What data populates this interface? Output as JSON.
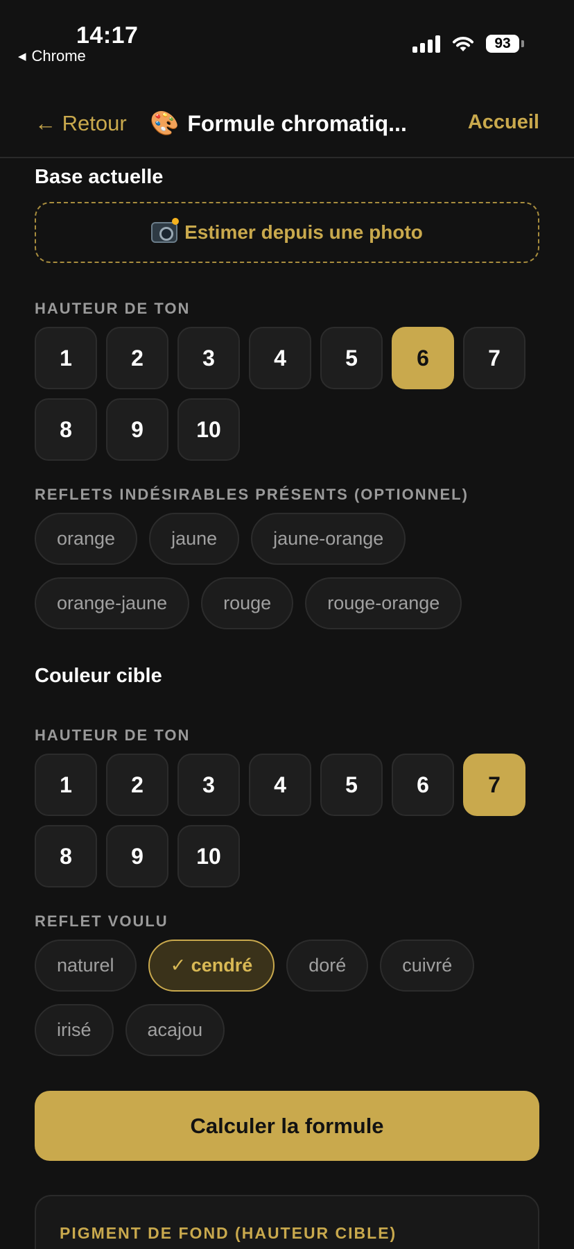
{
  "status_bar": {
    "time": "14:17",
    "back_app": "Chrome",
    "battery": "93"
  },
  "nav": {
    "back_label": "← Retour",
    "title": "Formule chromatiq...",
    "home_label": "Accueil"
  },
  "base": {
    "section_title": "Base actuelle",
    "photo_button": "Estimer depuis une photo",
    "tone_label": "HAUTEUR DE TON",
    "tones": [
      "1",
      "2",
      "3",
      "4",
      "5",
      "6",
      "7",
      "8",
      "9",
      "10"
    ],
    "selected_tone": "6",
    "reflets_label": "REFLETS INDÉSIRABLES PRÉSENTS (OPTIONNEL)",
    "reflets": [
      "orange",
      "jaune",
      "jaune-orange",
      "orange-jaune",
      "rouge",
      "rouge-orange"
    ]
  },
  "target": {
    "section_title": "Couleur cible",
    "tone_label": "HAUTEUR DE TON",
    "tones": [
      "1",
      "2",
      "3",
      "4",
      "5",
      "6",
      "7",
      "8",
      "9",
      "10"
    ],
    "selected_tone": "7",
    "reflet_label": "REFLET VOULU",
    "reflets": [
      "naturel",
      "✓ cendré",
      "doré",
      "cuivré",
      "irisé",
      "acajou"
    ],
    "selected_reflet": "✓ cendré"
  },
  "calculate_button": "Calculer la formule",
  "result": {
    "label": "PIGMENT DE FOND (HAUTEUR CIBLE)"
  },
  "colors": {
    "accent": "#c9a94d",
    "background": "#121212"
  }
}
